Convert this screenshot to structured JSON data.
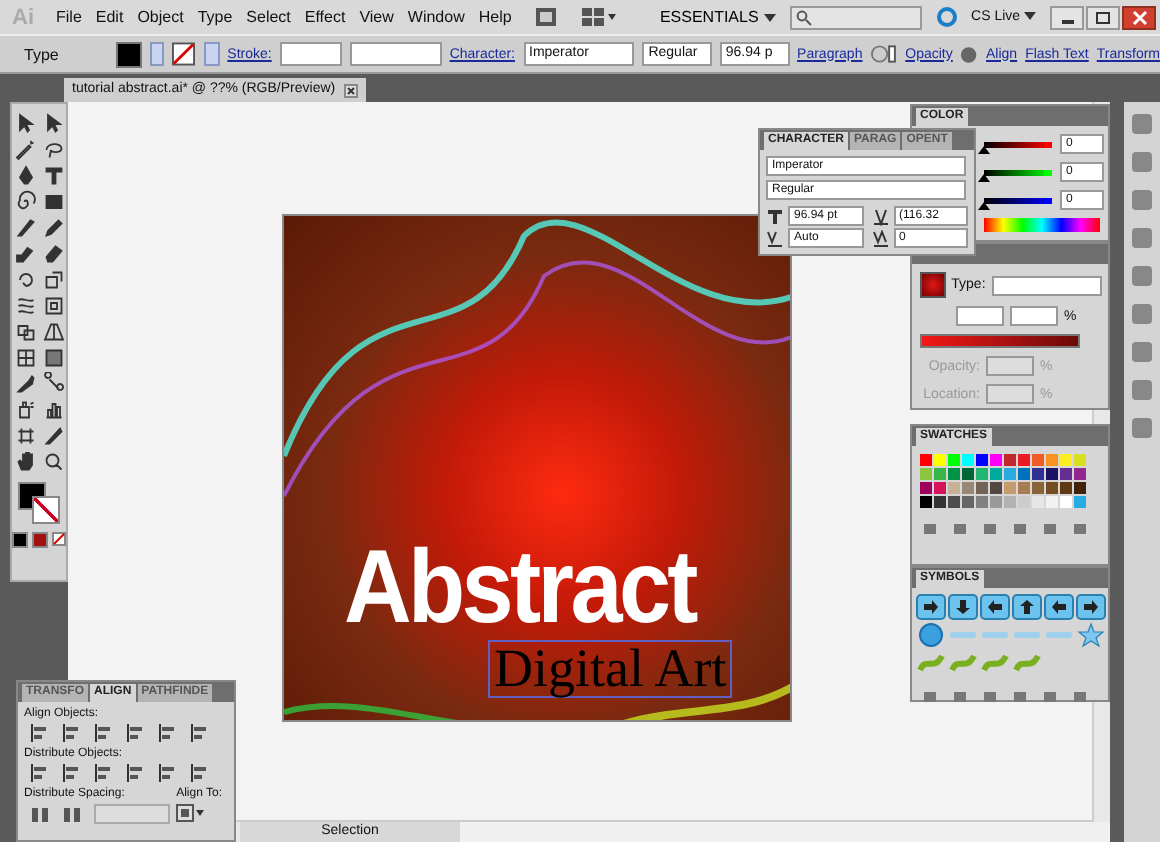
{
  "menu_bar": {
    "logo": "Ai",
    "items": [
      "File",
      "Edit",
      "Object",
      "Type",
      "Select",
      "Effect",
      "View",
      "Window",
      "Help"
    ],
    "workspace": "ESSENTIALS",
    "cs_live": "CS Live"
  },
  "control_bar": {
    "tool": "Type",
    "stroke_label": "Stroke:",
    "character_label": "Character:",
    "font": "Imperator",
    "style": "Regular",
    "size": "96.94 p",
    "links": [
      "Paragraph",
      "Opacity",
      "Align",
      "Flash Text",
      "Transform"
    ]
  },
  "document": {
    "tab": "tutorial abstract.ai* @ ??% (RGB/Preview)",
    "artwork": {
      "title": "Abstract",
      "subtitle": "Digital Art"
    }
  },
  "character_panel": {
    "tabs": [
      {
        "label": "CHARACTER",
        "selected": true
      },
      {
        "label": "PARAG",
        "selected": false
      },
      {
        "label": "OPENT",
        "selected": false
      }
    ],
    "font": "Imperator",
    "style": "Regular",
    "size": "96.94 pt",
    "leading": "(116.32",
    "kerning": "Auto",
    "tracking": "0"
  },
  "color_panel": {
    "title": "COLOR",
    "channels": [
      {
        "color": "#ff0000",
        "level": 0,
        "reading": "0"
      },
      {
        "color": "#00ff00",
        "level": 0,
        "reading": "0"
      },
      {
        "color": "#0000ff",
        "level": 0,
        "reading": "0"
      }
    ]
  },
  "gradient_panel": {
    "type_label": "Type:",
    "percent": "%",
    "opacity_label": "Opacity:",
    "location_label": "Location:",
    "disabled": true
  },
  "swatches_panel": {
    "title": "SWATCHES",
    "swatches": [
      {
        "color": "#ff0000"
      },
      {
        "color": "#ffff00"
      },
      {
        "color": "#00ff00"
      },
      {
        "color": "#00ffff"
      },
      {
        "color": "#0000ff"
      },
      {
        "color": "#ff00ff"
      },
      {
        "color": "#c1272d"
      },
      {
        "color": "#ed1c24"
      },
      {
        "color": "#f15a24"
      },
      {
        "color": "#f7931e"
      },
      {
        "color": "#fcee21"
      },
      {
        "color": "#d9e021"
      },
      {
        "color": "#8cc63f"
      },
      {
        "color": "#39b54a"
      },
      {
        "color": "#009245"
      },
      {
        "color": "#006837"
      },
      {
        "color": "#22b573"
      },
      {
        "color": "#00a99d"
      },
      {
        "color": "#29abe2"
      },
      {
        "color": "#0071bc"
      },
      {
        "color": "#2e3192"
      },
      {
        "color": "#1b1464"
      },
      {
        "color": "#662d91"
      },
      {
        "color": "#93278f"
      },
      {
        "color": "#9e005d"
      },
      {
        "color": "#d4145a"
      },
      {
        "color": "#c7b299"
      },
      {
        "color": "#998675"
      },
      {
        "color": "#736357"
      },
      {
        "color": "#534741"
      },
      {
        "color": "#c69c6d"
      },
      {
        "color": "#a67c52"
      },
      {
        "color": "#8c6239"
      },
      {
        "color": "#754c24"
      },
      {
        "color": "#603813"
      },
      {
        "color": "#42210b"
      },
      {
        "color": "#000000"
      },
      {
        "color": "#333333"
      },
      {
        "color": "#4d4d4d"
      },
      {
        "color": "#666666"
      },
      {
        "color": "#808080"
      },
      {
        "color": "#999999"
      },
      {
        "color": "#b3b3b3"
      },
      {
        "color": "#cccccc"
      },
      {
        "color": "#e6e6e6"
      },
      {
        "color": "#f2f2f2"
      },
      {
        "color": "#ffffff"
      },
      {
        "color": "#29abe2"
      }
    ]
  },
  "symbols_panel": {
    "title": "SYMBOLS"
  },
  "align_panel": {
    "tabs": [
      {
        "label": "TRANSFO",
        "selected": false
      },
      {
        "label": "ALIGN",
        "selected": true
      },
      {
        "label": "PATHFINDE",
        "selected": false
      }
    ],
    "sections": [
      "Align Objects:",
      "Distribute Objects:",
      "Distribute Spacing:"
    ],
    "align_to": "Align To:"
  },
  "status_bar": {
    "tool": "Selection"
  }
}
